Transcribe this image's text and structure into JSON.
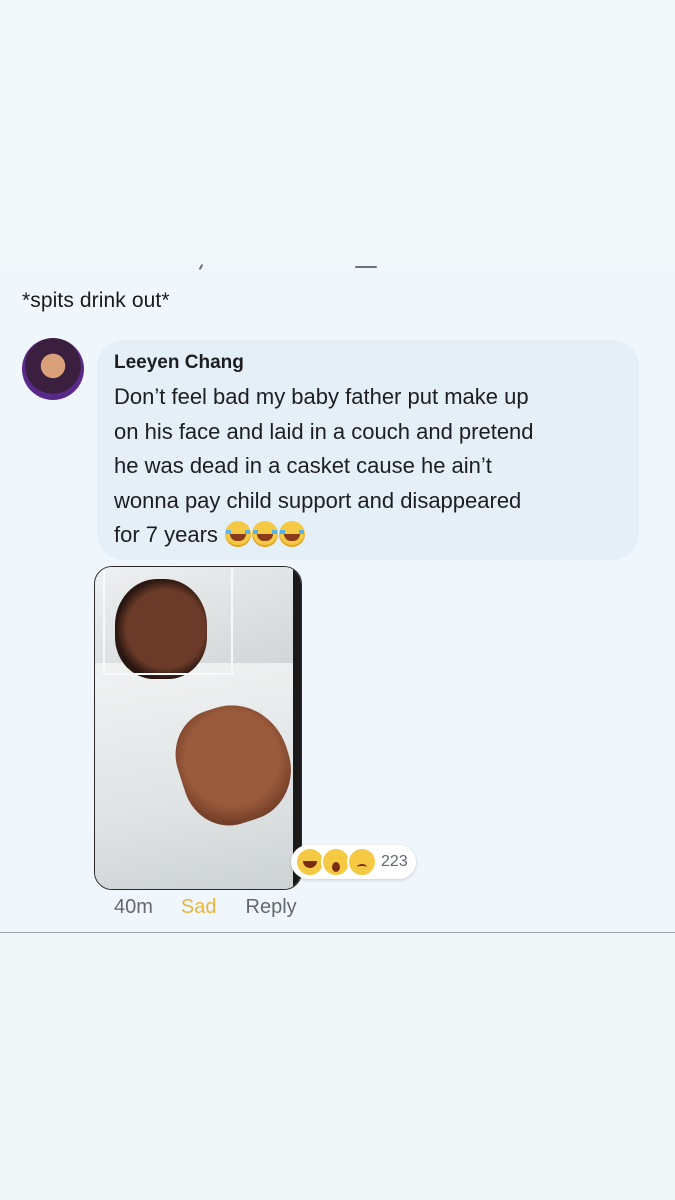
{
  "post": {
    "caption": "*spits drink out*"
  },
  "comment": {
    "author": "Leeyen Chang",
    "text_lines": [
      "Don’t feel bad my baby father put make up",
      "on his face and laid in a couch and pretend",
      "he was dead in a casket cause he ain’t",
      "wonna pay child support and disappeared",
      "for 7 years"
    ],
    "trailing_emoji": [
      "tears-of-joy-icon",
      "tears-of-joy-icon",
      "tears-of-joy-icon"
    ],
    "attachment": "photo",
    "reactions": {
      "icons": [
        "haha-icon",
        "wow-icon",
        "sad-icon"
      ],
      "count": "223"
    },
    "meta": {
      "time": "40m",
      "reaction_label": "Sad",
      "reply_label": "Reply"
    }
  },
  "colors": {
    "background": "#f0f7fc",
    "bubble": "#e4eff8",
    "sad_reaction": "#e9b43a",
    "muted_text": "#65676b"
  }
}
